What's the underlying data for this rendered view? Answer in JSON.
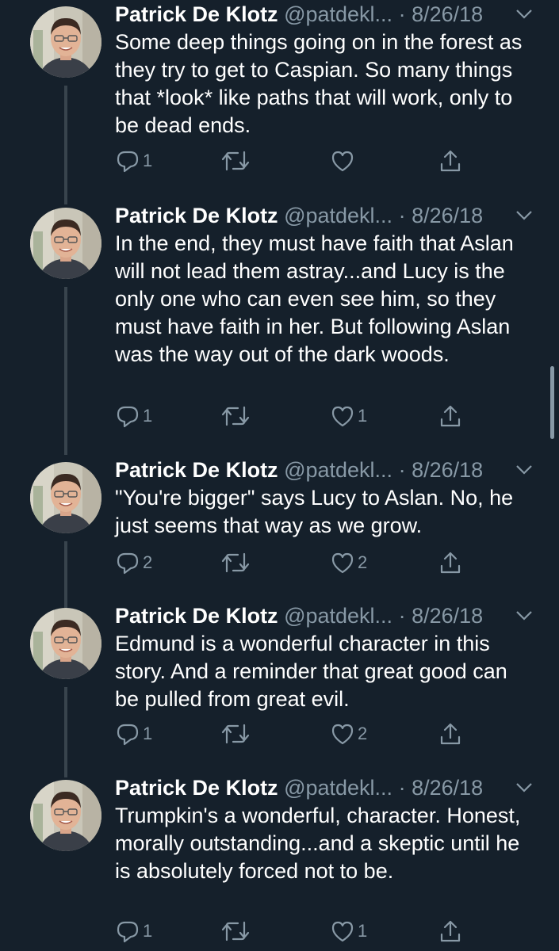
{
  "tweets": [
    {
      "name": "Patrick De Klotz",
      "handle": "@patdekl...",
      "sep": " · ",
      "date": "8/26/18",
      "text": "Some deep things going on in the forest as they try to get to Caspian. So many things that *look* like paths that will work, only to be dead ends.",
      "replies": "1",
      "retweets": "",
      "likes": ""
    },
    {
      "name": "Patrick De Klotz",
      "handle": "@patdekl...",
      "sep": " · ",
      "date": "8/26/18",
      "text": "In the end, they must have faith that Aslan will not lead them astray...and Lucy is the only one who can even see him, so they must have faith in her. But following Aslan was the way out of the dark woods.",
      "replies": "1",
      "retweets": "",
      "likes": "1"
    },
    {
      "name": "Patrick De Klotz",
      "handle": "@patdekl...",
      "sep": " · ",
      "date": "8/26/18",
      "text": "\"You're bigger\" says Lucy to Aslan. No, he just seems that way as we grow.",
      "replies": "2",
      "retweets": "",
      "likes": "2"
    },
    {
      "name": "Patrick De Klotz",
      "handle": "@patdekl...",
      "sep": " · ",
      "date": "8/26/18",
      "text": "Edmund is a wonderful character in this story. And a reminder that great good can be pulled from great evil.",
      "replies": "1",
      "retweets": "",
      "likes": "2"
    },
    {
      "name": "Patrick De Klotz",
      "handle": "@patdekl...",
      "sep": " · ",
      "date": "8/26/18",
      "text": "Trumpkin's a wonderful, character. Honest, morally outstanding...and a skeptic until he is absolutely forced not to be.",
      "replies": "1",
      "retweets": "",
      "likes": "1"
    }
  ],
  "icons": {
    "reply": "reply-icon",
    "retweet": "retweet-icon",
    "like": "heart-icon",
    "share": "share-icon",
    "caret": "chevron-down-icon"
  },
  "colors": {
    "background": "#15202b",
    "secondary_text": "#8899a6",
    "thread_line": "#38444d"
  }
}
